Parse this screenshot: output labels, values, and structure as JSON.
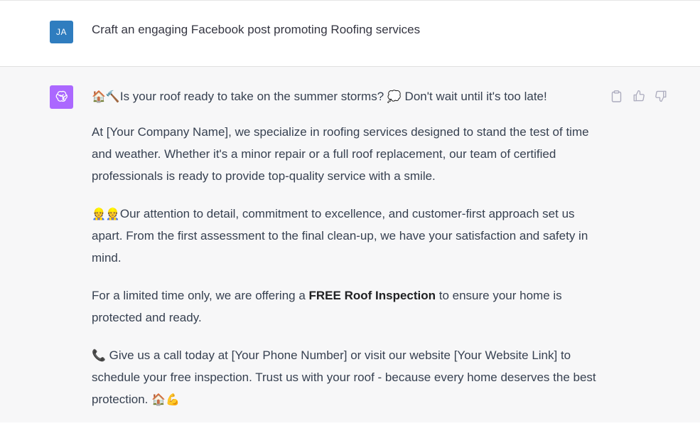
{
  "user_message": {
    "avatar_initials": "JA",
    "avatar_color": "#2f7dbf",
    "text": "Craft an engaging Facebook post promoting Roofing services"
  },
  "assistant_message": {
    "avatar_icon": "openai-logo-icon",
    "avatar_color": "#ab68ff",
    "p1_emoji": "🏠🔨",
    "p1_text": "Is your roof ready to take on the summer storms? ",
    "p1_emoji2": "💭",
    "p1_text2": " Don't wait until it's too late!",
    "p2": "At [Your Company Name], we specialize in roofing services designed to stand the test of time and weather. Whether it's a minor repair or a full roof replacement, our team of certified professionals is ready to provide top-quality service with a smile.",
    "p3_emoji": "👷👷",
    "p3_text": "Our attention to detail, commitment to excellence, and customer-first approach set us apart. From the first assessment to the final clean-up, we have your satisfaction and safety in mind.",
    "p4_before": "For a limited time only, we are offering a ",
    "p4_bold": "FREE Roof Inspection",
    "p4_after": " to ensure your home is protected and ready.",
    "p5_emoji": "📞",
    "p5_text": " Give us a call today at [Your Phone Number] or visit our website [Your Website Link] to schedule your free inspection. Trust us with your roof - because every home deserves the best protection. ",
    "p5_end_emoji": "🏠💪"
  },
  "actions": [
    "copy-icon",
    "thumbs-up-icon",
    "thumbs-down-icon"
  ]
}
